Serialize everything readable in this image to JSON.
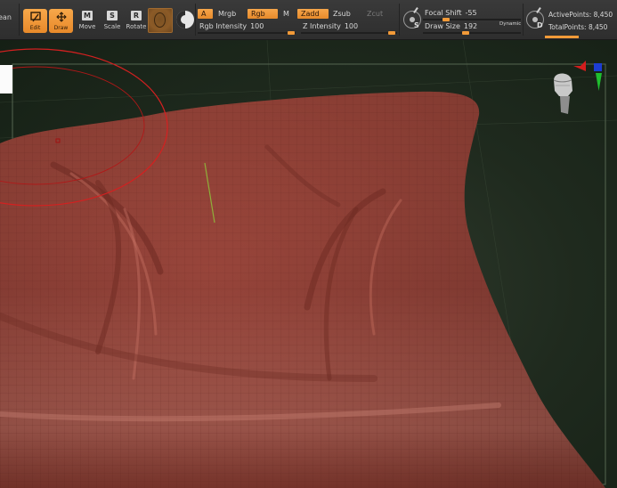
{
  "toolbar": {
    "cut_label": "ean",
    "edit_label": "Edit",
    "draw_label": "Draw",
    "move_label": "Move",
    "move_glyph": "M",
    "scale_label": "Scale",
    "scale_glyph": "S",
    "rotate_label": "Rotate",
    "rotate_glyph": "R",
    "a_label": "A",
    "mrgb_label": "Mrgb",
    "rgb_label": "Rgb",
    "m_label": "M",
    "zadd_label": "Zadd",
    "zsub_label": "Zsub",
    "zcut_label": "Zcut",
    "rgb_intensity": {
      "label": "Rgb Intensity",
      "value": "100"
    },
    "z_intensity": {
      "label": "Z Intensity",
      "value": "100"
    },
    "focal_shift": {
      "label": "Focal Shift",
      "value": "-55"
    },
    "draw_size": {
      "label": "Draw Size",
      "value": "192"
    },
    "dynamic_label": "Dynamic",
    "s_letter": "S",
    "d_letter": "D",
    "active_points": {
      "label": "ActivePoints:",
      "value": "8,450"
    },
    "total_points": {
      "label": "TotalPoints:",
      "value": "8,450"
    }
  },
  "icons": {
    "edit": "edit-icon",
    "draw": "draw-move-arrows-icon",
    "material": "material-sphere-icon",
    "color": "color-yin-yang-icon",
    "focal": "brush-circle-icon",
    "drawsize": "brush-circle-icon",
    "gizmo": "head-orientation-gizmo-icon"
  },
  "colors": {
    "accent": "#f29a38",
    "mesh": "#9a4337",
    "background": "#1f2a1e",
    "brush_ring": "#d42020"
  }
}
